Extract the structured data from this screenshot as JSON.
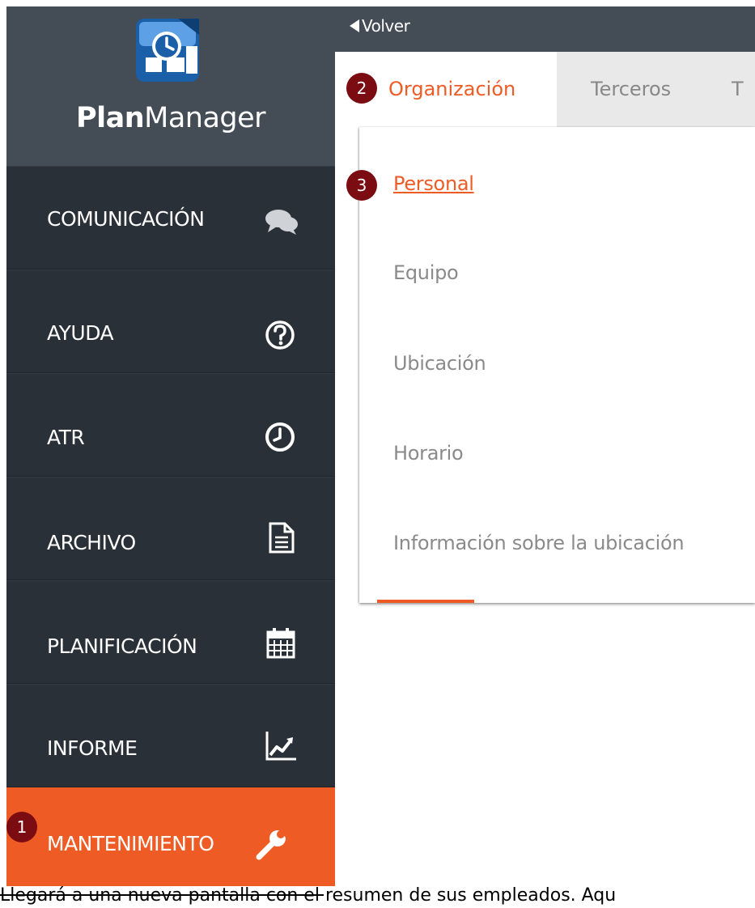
{
  "brand": {
    "name_bold": "Plan",
    "name_regular": "Manager"
  },
  "sidebar": {
    "items": [
      {
        "label": "COMUNICACIÓN",
        "icon": "chat-bubbles-icon"
      },
      {
        "label": "AYUDA",
        "icon": "help-circle-icon"
      },
      {
        "label": "ATR",
        "icon": "clock-icon"
      },
      {
        "label": "ARCHIVO",
        "icon": "file-icon"
      },
      {
        "label": "PLANIFICACIÓN",
        "icon": "calendar-icon"
      },
      {
        "label": "INFORME",
        "icon": "line-chart-icon"
      },
      {
        "label": "MANTENIMIENTO",
        "icon": "wrench-icon",
        "active": true
      }
    ]
  },
  "topbar": {
    "back_label": "Volver"
  },
  "tabs": [
    {
      "label": "Organización",
      "active": true
    },
    {
      "label": "Terceros"
    },
    {
      "label": "T"
    }
  ],
  "menu": {
    "items": [
      {
        "label": "Personal",
        "active": true
      },
      {
        "label": "Equipo"
      },
      {
        "label": "Ubicación"
      },
      {
        "label": "Horario"
      },
      {
        "label": "Información sobre la ubicación"
      }
    ]
  },
  "badges": [
    "1",
    "2",
    "3"
  ],
  "caption": "Llegará a una nueva pantalla con el resumen de sus empleados. Aqu",
  "colors": {
    "accent": "#ef5b25",
    "sidebar": "#2a3037",
    "header": "#444c55",
    "badge": "#7a0c12"
  }
}
